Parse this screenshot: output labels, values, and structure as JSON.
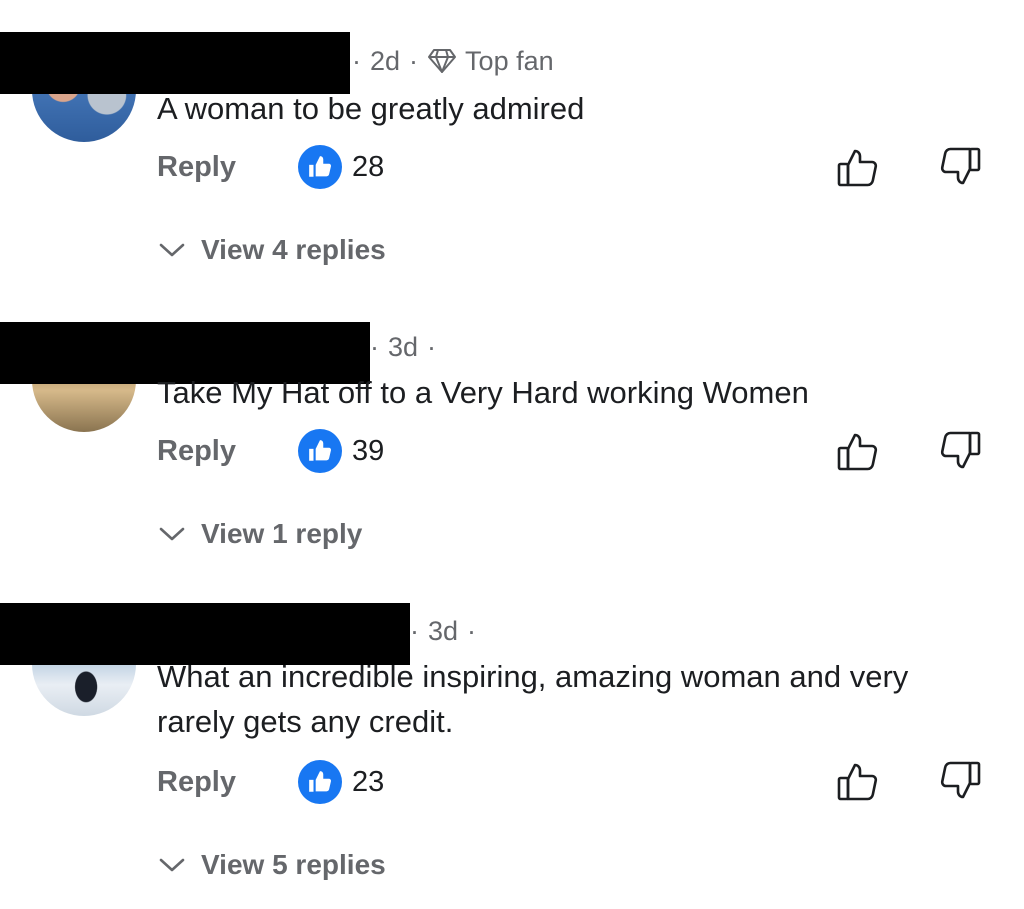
{
  "comments": [
    {
      "time": "2d",
      "badge": "Top fan",
      "text": "A woman to be greatly admired",
      "reply_label": "Reply",
      "likes": "28",
      "view_replies": "View 4 replies"
    },
    {
      "time": "3d",
      "text": "Take My Hat off to a Very Hard working Women",
      "reply_label": "Reply",
      "likes": "39",
      "view_replies": "View 1 reply"
    },
    {
      "time": "3d",
      "text": "What an incredible inspiring, amazing woman and very rarely gets any credit.",
      "reply_label": "Reply",
      "likes": "23",
      "view_replies": "View 5 replies"
    }
  ],
  "icons": {
    "badge": "diamond-icon",
    "like": "thumbs-up-icon",
    "dislike": "thumbs-down-icon",
    "expand": "chevron-down-icon"
  },
  "colors": {
    "accent": "#1877f2",
    "secondary_text": "#65676b",
    "primary_text": "#1c1e21"
  }
}
